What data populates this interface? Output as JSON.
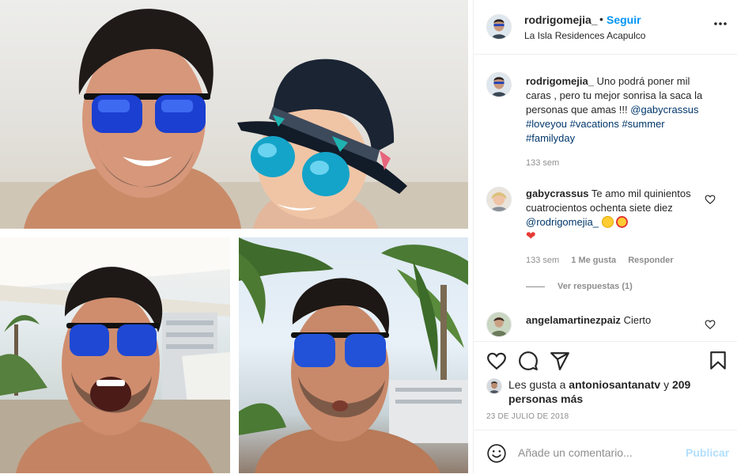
{
  "header": {
    "username": "rodrigomejia_",
    "separator": "•",
    "follow_label": "Seguir",
    "location": "La Isla Residences Acapulco",
    "more_icon": "more-horizontal-icon"
  },
  "caption": {
    "username": "rodrigomejia_",
    "text": "Uno podrá poner mil caras , pero tu mejor sonrisa la saca la personas que amas !!!",
    "mention": "@gabycrassus",
    "hashtags": [
      "#loveyou",
      "#vacations",
      "#summer",
      "#familyday"
    ],
    "time": "133 sem"
  },
  "comments": [
    {
      "username": "gabycrassus",
      "text": "Te amo mil quinientos cuatrocientos ochenta siete diez",
      "mention": "@rodrigomejia_",
      "emojis": [
        "kissing-face-emoji",
        "heart-eyes-emoji",
        "red-heart-emoji"
      ],
      "time": "133 sem",
      "likes": "1 Me gusta",
      "reply_label": "Responder",
      "view_replies": "Ver respuestas (1)"
    },
    {
      "username": "angelamartinezpaiz",
      "text": "Cierto"
    }
  ],
  "actions": {
    "like_icon": "heart-icon",
    "comment_icon": "comment-icon",
    "share_icon": "send-icon",
    "save_icon": "bookmark-icon"
  },
  "likes": {
    "prefix": "Les gusta a",
    "user": "antoniosantanatv",
    "and": "y",
    "others": "209 personas más"
  },
  "date": "23 DE JULIO DE 2018",
  "add_comment": {
    "placeholder": "Añade un comentario...",
    "post_label": "Publicar",
    "emoji_icon": "smiley-icon"
  },
  "colors": {
    "link": "#00376b",
    "follow": "#0095f6",
    "post_disabled": "#b2dffc",
    "muted": "#8e8e8e",
    "like_heart": "#ed4956"
  }
}
